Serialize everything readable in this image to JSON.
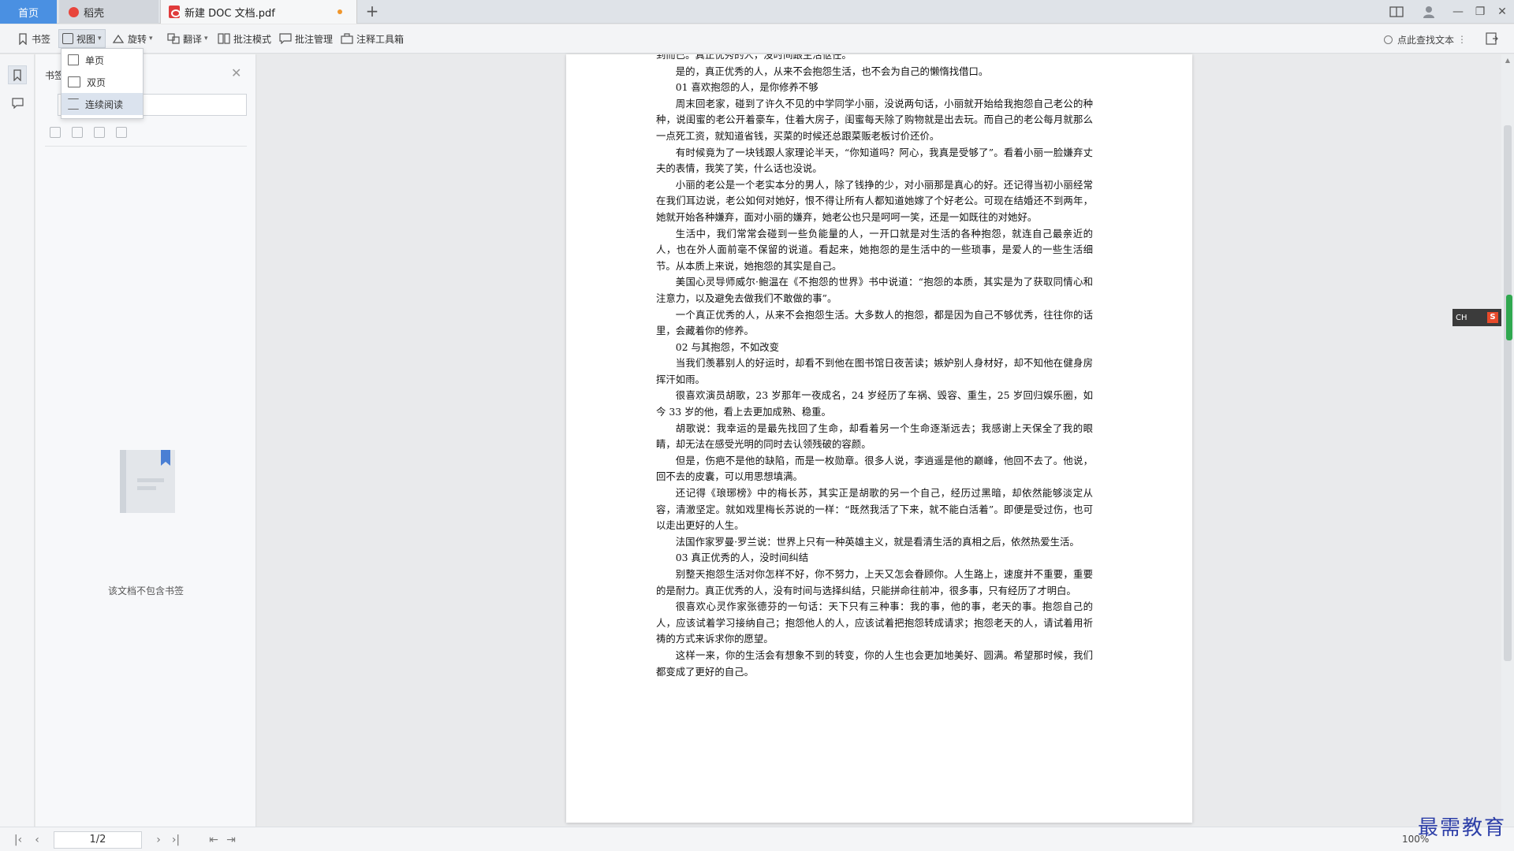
{
  "tabs": {
    "home": "首页",
    "daoke": "稻壳",
    "document": "新建 DOC 文档.pdf",
    "add": "+"
  },
  "window": {
    "minimize": "—",
    "restore": "❐",
    "close": "✕"
  },
  "toolbar": {
    "bookmark": "书签",
    "view": "视图",
    "rotate": "旋转",
    "translate": "翻译",
    "annotate_mode": "批注模式",
    "annotate_manage": "批注管理",
    "annotate_tools": "注释工具箱",
    "search_text": "点此查找文本"
  },
  "view_menu": {
    "single": "单页",
    "double": "双页",
    "continuous": "连续阅读"
  },
  "bookmark_panel": {
    "title": "书签",
    "empty": "该文档不包含书签"
  },
  "document": {
    "paragraphs": [
      {
        "text": "到而已。真正优秀的人，没时间跟生活怄任。",
        "cut": true
      },
      {
        "text": "是的，真正优秀的人，从来不会抱怨生活，也不会为自己的懒惰找借口。"
      },
      {
        "text": "01 喜欢抱怨的人，是你修养不够"
      },
      {
        "text": "周末回老家，碰到了许久不见的中学同学小丽，没说两句话，小丽就开始给我抱怨自己老公的种种，说闺蜜的老公开着豪车，住着大房子，闺蜜每天除了购物就是出去玩。而自己的老公每月就那么一点死工资，就知道省钱，买菜的时候还总跟菜贩老板讨价还价。"
      },
      {
        "text": "有时候竟为了一块钱跟人家理论半天，“你知道吗？阿心，我真是受够了”。看着小丽一脸嫌弃丈夫的表情，我笑了笑，什么话也没说。"
      },
      {
        "text": "小丽的老公是一个老实本分的男人，除了钱挣的少，对小丽那是真心的好。还记得当初小丽经常在我们耳边说，老公如何对她好，恨不得让所有人都知道她嫁了个好老公。可现在结婚还不到两年，她就开始各种嫌弃，面对小丽的嫌弃，她老公也只是呵呵一笑，还是一如既往的对她好。"
      },
      {
        "text": "生活中，我们常常会碰到一些负能量的人，一开口就是对生活的各种抱怨，就连自己最亲近的人，也在外人面前毫不保留的说道。看起来，她抱怨的是生活中的一些琐事，是爱人的一些生活细节。从本质上来说，她抱怨的其实是自己。"
      },
      {
        "text": "美国心灵导师威尔·鲍温在《不抱怨的世界》书中说道：“抱怨的本质，其实是为了获取同情心和注意力，以及避免去做我们不敢做的事”。"
      },
      {
        "text": "一个真正优秀的人，从来不会抱怨生活。大多数人的抱怨，都是因为自己不够优秀，往往你的话里，会藏着你的修养。"
      },
      {
        "text": "02 与其抱怨，不如改变"
      },
      {
        "text": "当我们羡慕别人的好运时，却看不到他在图书馆日夜苦读；嫉妒别人身材好，却不知他在健身房挥汗如雨。"
      },
      {
        "text": "很喜欢演员胡歌，23 岁那年一夜成名，24 岁经历了车祸、毁容、重生，25 岁回归娱乐圈，如今 33 岁的他，看上去更加成熟、稳重。"
      },
      {
        "text": "胡歌说：我幸运的是最先找回了生命，却看着另一个生命逐渐远去；我感谢上天保全了我的眼睛，却无法在感受光明的同时去认领残破的容颜。"
      },
      {
        "text": "但是，伤疤不是他的缺陷，而是一枚勋章。很多人说，李逍遥是他的巅峰，他回不去了。他说，回不去的皮囊，可以用思想填满。"
      },
      {
        "text": "还记得《琅琊榜》中的梅长苏，其实正是胡歌的另一个自己，经历过黑暗，却依然能够淡定从容，清澈坚定。就如戏里梅长苏说的一样：“既然我活了下来，就不能白活着”。即便是受过伤，也可以走出更好的人生。"
      },
      {
        "text": "法国作家罗曼·罗兰说：世界上只有一种英雄主义，就是看清生活的真相之后，依然热爱生活。"
      },
      {
        "text": "03 真正优秀的人，没时间纠结"
      },
      {
        "text": "别整天抱怨生活对你怎样不好，你不努力，上天又怎会眷顾你。人生路上，速度并不重要，重要的是耐力。真正优秀的人，没有时间与选择纠结，只能拼命往前冲，很多事，只有经历了才明白。"
      },
      {
        "text": "很喜欢心灵作家张德芬的一句话：天下只有三种事：我的事，他的事，老天的事。抱怨自己的人，应该试着学习接纳自己；抱怨他人的人，应该试着把抱怨转成请求；抱怨老天的人，请试着用祈祷的方式来诉求你的愿望。"
      },
      {
        "text": "这样一来，你的生活会有想象不到的转变，你的人生也会更加地美好、圆满。希望那时候，我们都变成了更好的自己。"
      }
    ]
  },
  "ime": {
    "label": "CH",
    "badge": "S"
  },
  "statusbar": {
    "page": "1/2",
    "zoom": "100%"
  },
  "watermark": "最需教育"
}
